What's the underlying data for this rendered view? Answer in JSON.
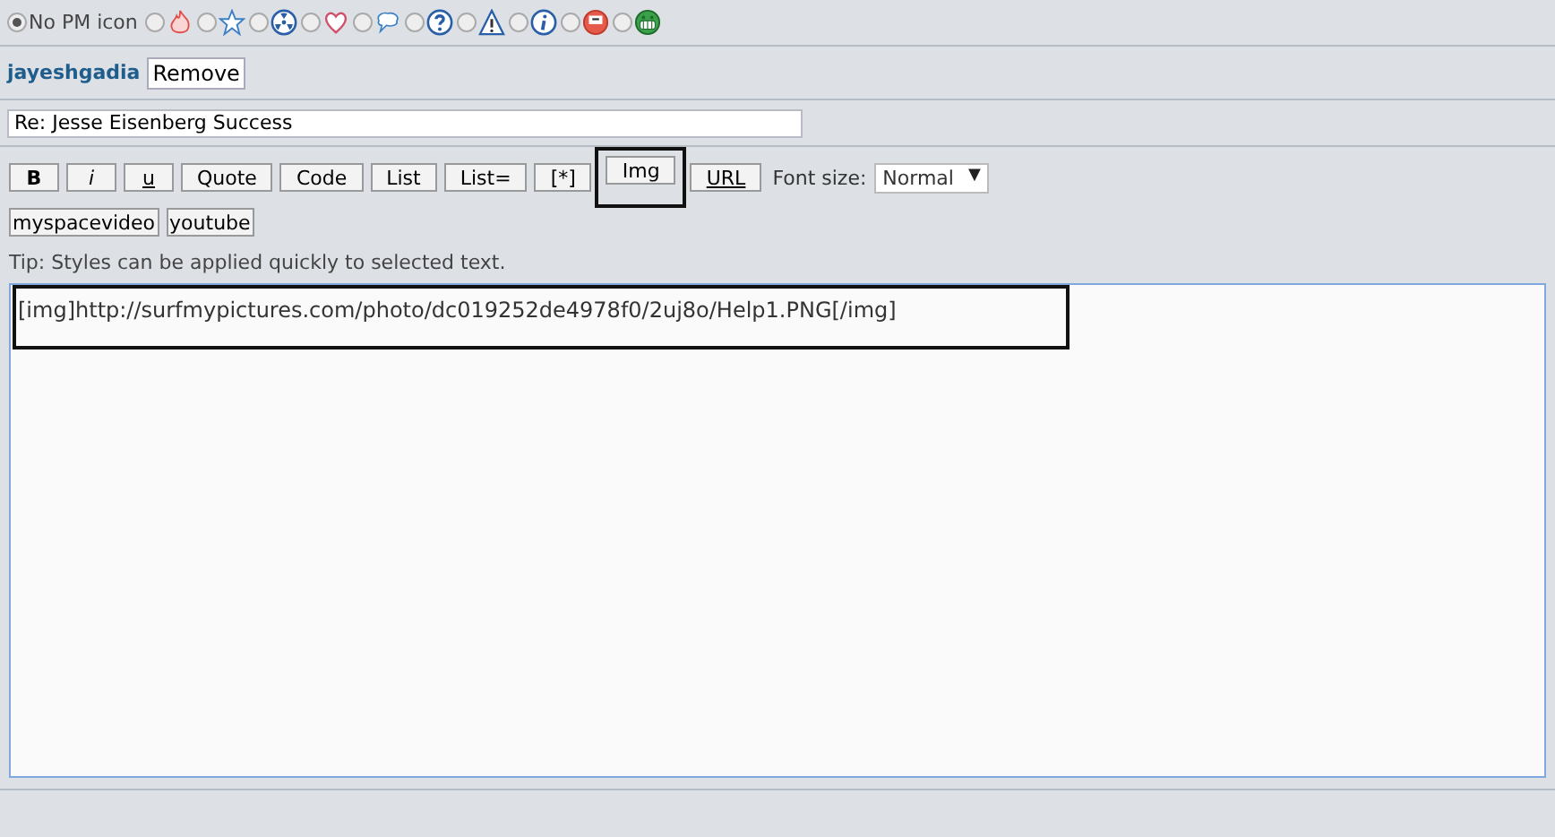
{
  "pm_icons": [
    {
      "kind": "none",
      "label": "No PM icon",
      "selected": true
    },
    {
      "kind": "fire",
      "selected": false
    },
    {
      "kind": "star",
      "selected": false
    },
    {
      "kind": "radiation",
      "selected": false
    },
    {
      "kind": "heart",
      "selected": false
    },
    {
      "kind": "speech",
      "selected": false
    },
    {
      "kind": "question",
      "selected": false
    },
    {
      "kind": "warning",
      "selected": false
    },
    {
      "kind": "info",
      "selected": false
    },
    {
      "kind": "sad",
      "selected": false
    },
    {
      "kind": "grin",
      "selected": false
    }
  ],
  "recipient": {
    "name": "jayeshgadia",
    "remove": "Remove"
  },
  "subject": {
    "value": "Re: Jesse Eisenberg Success"
  },
  "toolbar": [
    {
      "label": "B",
      "kind": "bold",
      "highlighted": false
    },
    {
      "label": "i",
      "kind": "italic",
      "highlighted": false
    },
    {
      "label": "u",
      "kind": "underline",
      "highlighted": false
    },
    {
      "label": "Quote",
      "kind": "plain",
      "highlighted": false
    },
    {
      "label": "Code",
      "kind": "plain",
      "highlighted": false
    },
    {
      "label": "List",
      "kind": "plain",
      "highlighted": false
    },
    {
      "label": "List=",
      "kind": "plain",
      "highlighted": false
    },
    {
      "label": "[*]",
      "kind": "plain",
      "highlighted": false
    },
    {
      "label": "Img",
      "kind": "plain",
      "highlighted": true
    },
    {
      "label": "URL",
      "kind": "underline",
      "highlighted": false
    }
  ],
  "font_size": {
    "label": "Font size:",
    "value": "Normal",
    "arrow": "▼"
  },
  "extra_buttons": [
    "myspacevideo",
    "youtube"
  ],
  "tip": "Tip: Styles can be applied quickly to selected text.",
  "message": {
    "value": "[img]http://surfmypictures.com/photo/dc019252de4978f0/2uj8o/Help1.PNG[/img]",
    "highlighted": true
  }
}
